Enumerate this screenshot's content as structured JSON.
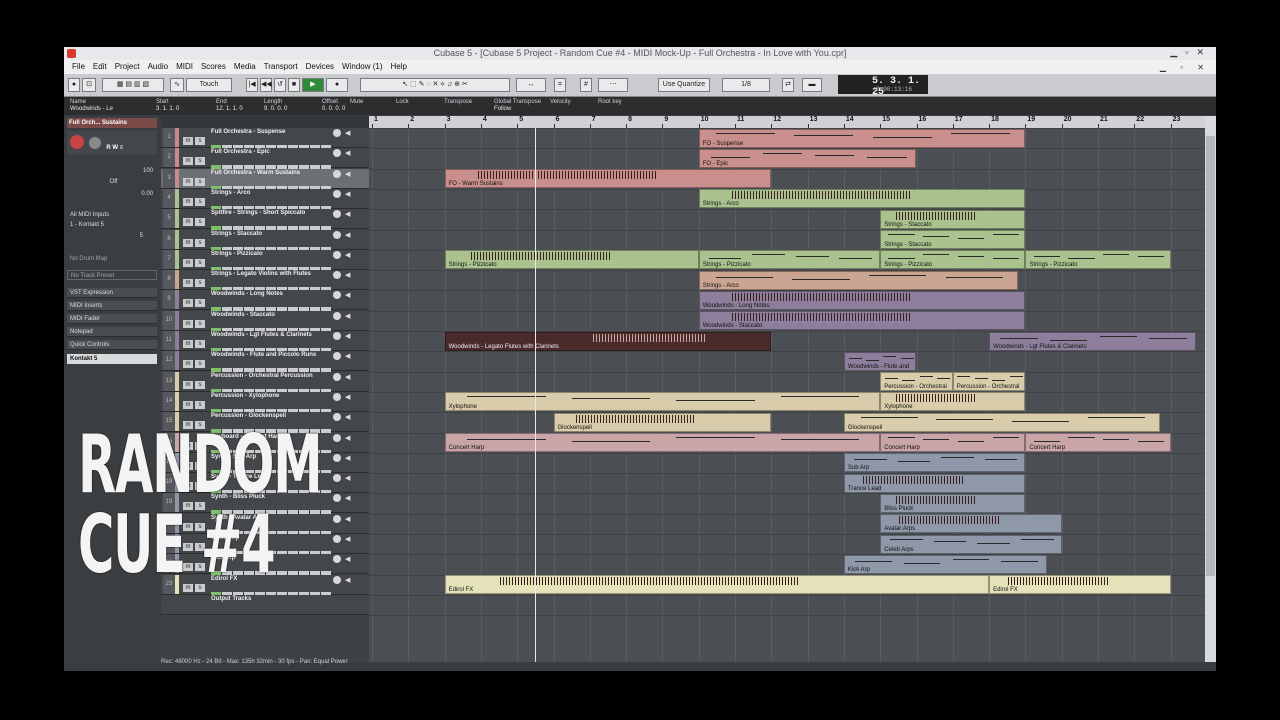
{
  "window": {
    "title": "Cubase 5 - [Cubase 5 Project - Random Cue #4 - MIDI Mock-Up - Full Orchestra - In Love with You.cpr]"
  },
  "menu": [
    "File",
    "Edit",
    "Project",
    "Audio",
    "MIDI",
    "Scores",
    "Media",
    "Transport",
    "Devices",
    "Window (1)",
    "Help"
  ],
  "toolbar": {
    "automation_mode": "Touch",
    "quantize": "Use Quantize",
    "quantize_value": "1/8"
  },
  "transport": {
    "position": "5. 3. 1. 25",
    "time": "0:00:13:16"
  },
  "infoline": {
    "labels": [
      "Name",
      "Start",
      "End",
      "Length",
      "Offset",
      "Mute",
      "Lock",
      "Transpose",
      "Global Transpose",
      "Velocity",
      "Root key"
    ],
    "values": [
      "Woodwinds - Le",
      "3. 1. 1.   0",
      "12. 1. 1.   0",
      "9. 0. 0.   0",
      "0. 0. 0.   0",
      "",
      "",
      "",
      "Follow",
      "",
      ""
    ]
  },
  "inspector": {
    "header": "Full Orch... Sustains",
    "volume": "100",
    "transpose": "Off",
    "pan": "0.00",
    "input": "All MIDI Inputs",
    "output": "1 - Kontakt 5",
    "channel": "5",
    "drum_map": "No Drum Map",
    "track_preset": "No Track Preset",
    "sections": [
      "VST Expression",
      "MIDI Inserts",
      "MIDI Fader",
      "Notepad",
      "Quick Controls"
    ],
    "instrument": "Kontakt 5"
  },
  "ruler": [
    "1",
    "2",
    "3",
    "4",
    "5",
    "6",
    "7",
    "8",
    "9",
    "10",
    "11",
    "12",
    "13",
    "14",
    "15",
    "16",
    "17",
    "18",
    "19",
    "20",
    "21",
    "22",
    "23"
  ],
  "tracks": [
    {
      "num": "1",
      "name": "Full Orchestra - Suspense",
      "color": "#c78b88"
    },
    {
      "num": "2",
      "name": "Full Orchestra - Epic",
      "color": "#c78b88"
    },
    {
      "num": "3",
      "name": "Full Orchestra - Warm Sustains",
      "color": "#c78b88"
    },
    {
      "num": "4",
      "name": "Strings - Arco",
      "color": "#a9c28e"
    },
    {
      "num": "5",
      "name": "Spitfire - Strings - Short Spiccato",
      "color": "#a9c28e"
    },
    {
      "num": "6",
      "name": "Strings - Staccato",
      "color": "#a9c28e"
    },
    {
      "num": "7",
      "name": "Strings - Pizzicato",
      "color": "#a9c28e"
    },
    {
      "num": "8",
      "name": "Strings - Legato Violins with Flutes",
      "color": "#c9a592"
    },
    {
      "num": "9",
      "name": "Woodwinds - Long Notes",
      "color": "#8d7f9c"
    },
    {
      "num": "10",
      "name": "Woodwinds - Staccato",
      "color": "#8d7f9c"
    },
    {
      "num": "11",
      "name": "Woodwinds - Lgt Flutes & Clarinets",
      "color": "#8d7f9c"
    },
    {
      "num": "12",
      "name": "Woodwinds - Flute and Piccolo Runs",
      "color": "#8d7f9c"
    },
    {
      "num": "13",
      "name": "Percussion - Orchestral Percussion",
      "color": "#d8ccaa"
    },
    {
      "num": "14",
      "name": "Percussion - Xylophone",
      "color": "#d8ccaa"
    },
    {
      "num": "15",
      "name": "Percussion - Glockenspeil",
      "color": "#d8ccaa"
    },
    {
      "num": "16",
      "name": "Keyboard - Concert Harp",
      "color": "#c9a5a8"
    },
    {
      "num": "17",
      "name": "Synth - Sub Arp",
      "color": "#8f98a8"
    },
    {
      "num": "18",
      "name": "Synth - Trance Lead",
      "color": "#8f98a8"
    },
    {
      "num": "19",
      "name": "Synth - Bliss Pluck",
      "color": "#8f98a8"
    },
    {
      "num": "20",
      "name": "Synth - Avatar Arps",
      "color": "#8f98a8"
    },
    {
      "num": "21",
      "name": "Celeb Arp",
      "color": "#8f98a8"
    },
    {
      "num": "22",
      "name": "Kick Arp",
      "color": "#8f98a8"
    },
    {
      "num": "23",
      "name": "Edirol FX",
      "color": "#e4e2b8"
    }
  ],
  "output_tracks": "Output Tracks",
  "parts": [
    {
      "row": 0,
      "start": 10,
      "end": 19,
      "label": "FO - Suspense",
      "color": "#c98f8c"
    },
    {
      "row": 1,
      "start": 10,
      "end": 16,
      "label": "FO - Epic",
      "color": "#c98f8c"
    },
    {
      "row": 2,
      "start": 3,
      "end": 12,
      "label": "FO - Warm Sustains",
      "color": "#c98f8c"
    },
    {
      "row": 3,
      "start": 10,
      "end": 19,
      "label": "Strings - Arco",
      "color": "#a9c28e"
    },
    {
      "row": 4,
      "start": 15,
      "end": 19,
      "label": "Strings - Staccato",
      "color": "#a9c28e"
    },
    {
      "row": 5,
      "start": 15,
      "end": 19,
      "label": "Strings - Staccato",
      "color": "#a9c28e"
    },
    {
      "row": 6,
      "start": 3,
      "end": 10,
      "label": "Strings - Pizzicato",
      "color": "#a9c28e"
    },
    {
      "row": 6,
      "start": 10,
      "end": 15,
      "label": "Strings - Pizzicato",
      "color": "#a9c28e"
    },
    {
      "row": 6,
      "start": 15,
      "end": 19,
      "label": "Strings - Pizzicato",
      "color": "#a9c28e"
    },
    {
      "row": 6,
      "start": 19,
      "end": 23,
      "label": "Strings - Pizzicato",
      "color": "#a9c28e"
    },
    {
      "row": 7,
      "start": 10,
      "end": 18.8,
      "label": "Strings - Arco",
      "color": "#c9a592"
    },
    {
      "row": 8,
      "start": 10,
      "end": 19,
      "label": "Woodwinds - Long Notes",
      "color": "#8d7f9c"
    },
    {
      "row": 9,
      "start": 10,
      "end": 19,
      "label": "Woodwinds - Staccato",
      "color": "#8d7f9c"
    },
    {
      "row": 10,
      "start": 3,
      "end": 12,
      "label": "Woodwinds - Legato Flutes with Clarinets",
      "color": "#4a2a2a"
    },
    {
      "row": 10,
      "start": 18,
      "end": 23.7,
      "label": "Woodwinds - Lgt Flutes & Clarinets",
      "color": "#8d7f9c"
    },
    {
      "row": 11,
      "start": 14,
      "end": 16,
      "label": "Woodwinds - Flute and",
      "color": "#8d7f9c"
    },
    {
      "row": 12,
      "start": 15,
      "end": 17,
      "label": "Percussion - Orchestral",
      "color": "#d8ccaa"
    },
    {
      "row": 12,
      "start": 17,
      "end": 19,
      "label": "Percussion - Orchestral",
      "color": "#d8ccaa"
    },
    {
      "row": 13,
      "start": 3,
      "end": 15,
      "label": "Xylophone",
      "color": "#d8ccaa"
    },
    {
      "row": 13,
      "start": 15,
      "end": 19,
      "label": "Xylophone",
      "color": "#d8ccaa"
    },
    {
      "row": 14,
      "start": 6,
      "end": 12,
      "label": "Glockenspeil",
      "color": "#d8ccaa"
    },
    {
      "row": 14,
      "start": 14,
      "end": 22.7,
      "label": "Glockenspeil",
      "color": "#d8ccaa"
    },
    {
      "row": 15,
      "start": 3,
      "end": 15,
      "label": "Concert Harp",
      "color": "#c9a5a8"
    },
    {
      "row": 15,
      "start": 15,
      "end": 19,
      "label": "Concert Harp",
      "color": "#c9a5a8"
    },
    {
      "row": 15,
      "start": 19,
      "end": 23,
      "label": "Concert Harp",
      "color": "#c9a5a8"
    },
    {
      "row": 16,
      "start": 14,
      "end": 19,
      "label": "Sub Arp",
      "color": "#8f98a8"
    },
    {
      "row": 17,
      "start": 14,
      "end": 19,
      "label": "Trance Lead",
      "color": "#8f98a8"
    },
    {
      "row": 18,
      "start": 15,
      "end": 19,
      "label": "Bliss Pluck",
      "color": "#8f98a8"
    },
    {
      "row": 19,
      "start": 15,
      "end": 20,
      "label": "Avatar Arps",
      "color": "#8f98a8"
    },
    {
      "row": 20,
      "start": 15,
      "end": 20,
      "label": "Celeb Arps",
      "color": "#8f98a8"
    },
    {
      "row": 21,
      "start": 14,
      "end": 19.6,
      "label": "Kick Arp",
      "color": "#8f98a8"
    },
    {
      "row": 22,
      "start": 3,
      "end": 18,
      "label": "Edirol FX",
      "color": "#e4e2b8"
    },
    {
      "row": 22,
      "start": 18,
      "end": 23,
      "label": "Edirol FX",
      "color": "#e4e2b8"
    }
  ],
  "cursor_bar": 5.5,
  "status": "Rec: 48000 Hz - 24 Bit - Max: 135h 32min - 30 fps - Pan: Equal Power",
  "overlay": {
    "line1": "RANDOM",
    "line2": "CUE #4"
  }
}
